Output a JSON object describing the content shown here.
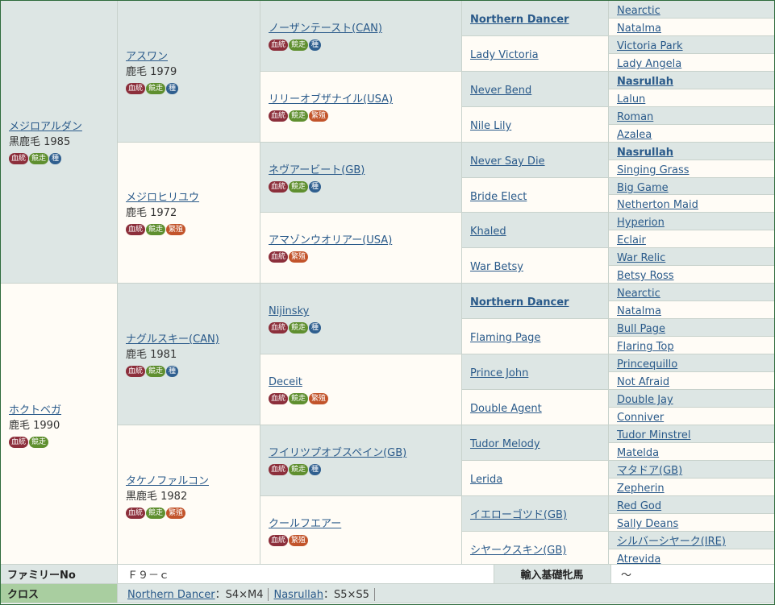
{
  "icon_labels": {
    "ket": "血統",
    "kyo": "競走",
    "shu": "種",
    "han": "繁殖"
  },
  "gen1": [
    {
      "name": "メジロアルダン",
      "info": "黒鹿毛 1985",
      "badges": [
        "ket",
        "kyo",
        "shu"
      ]
    },
    {
      "name": "ホクトベガ",
      "info": "鹿毛 1990",
      "badges": [
        "ket",
        "kyo"
      ]
    }
  ],
  "gen2": [
    {
      "name": "アスワン",
      "info": "鹿毛 1979",
      "badges": [
        "ket",
        "kyo",
        "shu"
      ]
    },
    {
      "name": "メジロヒリユウ",
      "info": "鹿毛 1972",
      "badges": [
        "ket",
        "kyo",
        "han"
      ]
    },
    {
      "name": "ナグルスキー(CAN)",
      "info": "鹿毛 1981",
      "badges": [
        "ket",
        "kyo",
        "shu"
      ]
    },
    {
      "name": "タケノファルコン",
      "info": "黒鹿毛 1982",
      "badges": [
        "ket",
        "kyo",
        "han"
      ]
    }
  ],
  "gen3": [
    {
      "name": "ノーザンテースト(CAN)",
      "badges": [
        "ket",
        "kyo",
        "shu"
      ]
    },
    {
      "name": "リリーオブザナイル(USA)",
      "badges": [
        "ket",
        "kyo",
        "han"
      ]
    },
    {
      "name": "ネヴアービート(GB)",
      "badges": [
        "ket",
        "kyo",
        "shu"
      ]
    },
    {
      "name": "アマゾンウオリアー(USA)",
      "badges": [
        "ket",
        "han"
      ]
    },
    {
      "name": "Nijinsky",
      "badges": [
        "ket",
        "kyo",
        "shu"
      ]
    },
    {
      "name": "Deceit",
      "badges": [
        "ket",
        "kyo",
        "han"
      ]
    },
    {
      "name": "フイリツプオブスペイン(GB)",
      "badges": [
        "ket",
        "kyo",
        "shu"
      ]
    },
    {
      "name": "クールフエアー",
      "badges": [
        "ket",
        "han"
      ]
    }
  ],
  "gen4": [
    {
      "name": "Northern Dancer",
      "bold": true
    },
    {
      "name": "Lady Victoria"
    },
    {
      "name": "Never Bend"
    },
    {
      "name": "Nile Lily"
    },
    {
      "name": "Never Say Die"
    },
    {
      "name": "Bride Elect"
    },
    {
      "name": "Khaled"
    },
    {
      "name": "War Betsy"
    },
    {
      "name": "Northern Dancer",
      "bold": true
    },
    {
      "name": "Flaming Page"
    },
    {
      "name": "Prince John"
    },
    {
      "name": "Double Agent"
    },
    {
      "name": "Tudor Melody"
    },
    {
      "name": "Lerida"
    },
    {
      "name": "イエローゴツド(GB)"
    },
    {
      "name": "シヤークスキン(GB)"
    }
  ],
  "gen5": [
    {
      "name": "Nearctic"
    },
    {
      "name": "Natalma"
    },
    {
      "name": "Victoria Park"
    },
    {
      "name": "Lady Angela"
    },
    {
      "name": "Nasrullah",
      "bold": true
    },
    {
      "name": "Lalun"
    },
    {
      "name": "Roman"
    },
    {
      "name": "Azalea"
    },
    {
      "name": "Nasrullah",
      "bold": true
    },
    {
      "name": "Singing Grass"
    },
    {
      "name": "Big Game"
    },
    {
      "name": "Netherton Maid"
    },
    {
      "name": "Hyperion"
    },
    {
      "name": "Eclair"
    },
    {
      "name": "War Relic"
    },
    {
      "name": "Betsy Ross"
    },
    {
      "name": "Nearctic"
    },
    {
      "name": "Natalma"
    },
    {
      "name": "Bull Page"
    },
    {
      "name": "Flaring Top"
    },
    {
      "name": "Princequillo"
    },
    {
      "name": "Not Afraid"
    },
    {
      "name": "Double Jay"
    },
    {
      "name": "Conniver"
    },
    {
      "name": "Tudor Minstrel"
    },
    {
      "name": "Matelda"
    },
    {
      "name": "マタドア(GB)"
    },
    {
      "name": "Zepherin"
    },
    {
      "name": "Red God"
    },
    {
      "name": "Sally Deans"
    },
    {
      "name": "シルバーシヤーク(IRE)"
    },
    {
      "name": "Atrevida"
    }
  ],
  "family": {
    "label": "ファミリーNo",
    "value": "Ｆ９－ｃ",
    "import_label": "輸入基礎牝馬",
    "import_value": "～"
  },
  "cross": {
    "label": "クロス",
    "items": [
      {
        "horse": "Northern Dancer",
        "text": "：S4×M4"
      },
      {
        "horse": "Nasrullah",
        "text": "：S5×S5"
      }
    ]
  }
}
